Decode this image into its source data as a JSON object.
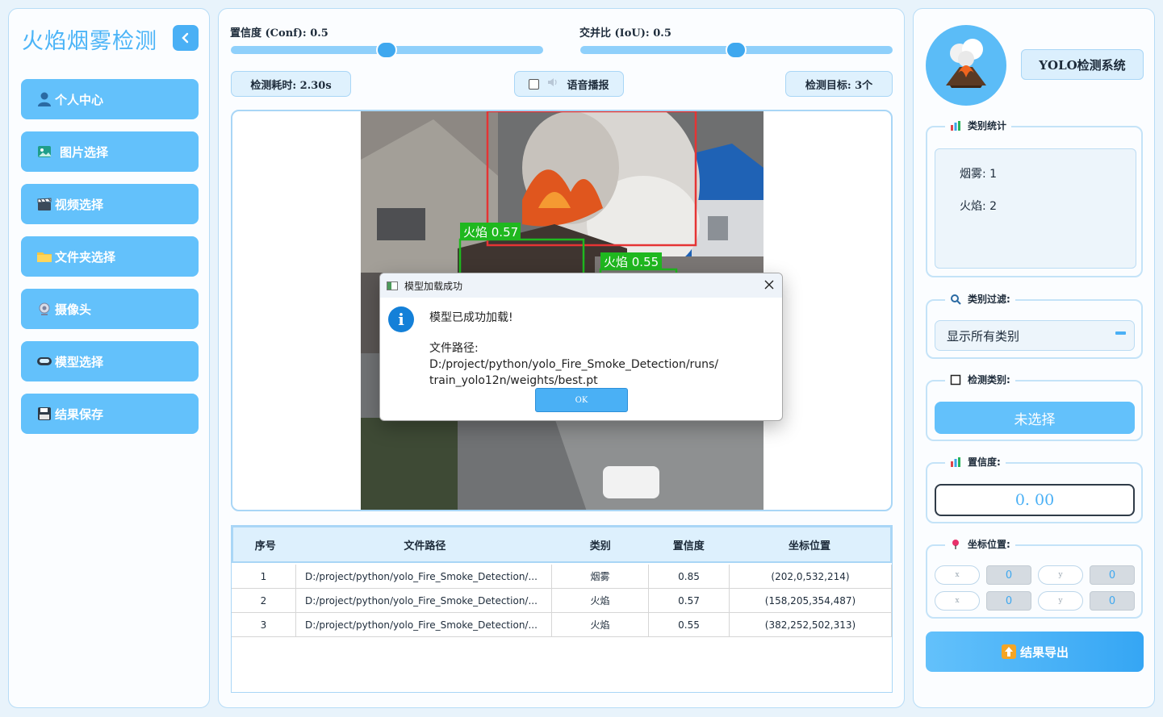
{
  "sidebar": {
    "title": "火焰烟雾检测",
    "items": [
      {
        "label": "个人中心",
        "icon": "user-icon"
      },
      {
        "label": "图片选择",
        "icon": "image-icon"
      },
      {
        "label": "视频选择",
        "icon": "clapper-icon"
      },
      {
        "label": "文件夹选择",
        "icon": "folder-icon"
      },
      {
        "label": "摄像头",
        "icon": "webcam-icon"
      },
      {
        "label": "模型选择",
        "icon": "model-icon"
      },
      {
        "label": "结果保存",
        "icon": "floppy-icon"
      }
    ]
  },
  "controls": {
    "conf_label": "置信度 (Conf): 0.5",
    "conf_value": 0.5,
    "iou_label": "交并比 (IoU): 0.5",
    "iou_value": 0.5,
    "time_label": "检测耗时: 2.30s",
    "voice_label": "语音播报",
    "target_label": "检测目标: 3个"
  },
  "detections_overlay": [
    {
      "label": "火焰 0.57",
      "color": "#1fb81f"
    },
    {
      "label": "火焰 0.55",
      "color": "#1fb81f"
    }
  ],
  "table": {
    "headers": [
      "序号",
      "文件路径",
      "类别",
      "置信度",
      "坐标位置"
    ],
    "rows": [
      {
        "idx": "1",
        "path": "D:/project/python/yolo_Fire_Smoke_Detection/...",
        "cls": "烟雾",
        "conf": "0.85",
        "box": "(202,0,532,214)"
      },
      {
        "idx": "2",
        "path": "D:/project/python/yolo_Fire_Smoke_Detection/...",
        "cls": "火焰",
        "conf": "0.57",
        "box": "(158,205,354,487)"
      },
      {
        "idx": "3",
        "path": "D:/project/python/yolo_Fire_Smoke_Detection/...",
        "cls": "火焰",
        "conf": "0.55",
        "box": "(382,252,502,313)"
      }
    ]
  },
  "right": {
    "system_title": "YOLO检测系统",
    "stats_label": "类别统计",
    "stats": [
      "烟雾: 1",
      "火焰: 2"
    ],
    "filter_label": "类别过滤:",
    "filter_value": "显示所有类别",
    "class_label": "检测类别:",
    "class_value": "未选择",
    "conf_label": "置信度:",
    "conf_value": "0. 00",
    "coord_label": "坐标位置:",
    "coords": [
      {
        "axis": "x",
        "value": "0"
      },
      {
        "axis": "y",
        "value": "0"
      },
      {
        "axis": "x",
        "value": "0"
      },
      {
        "axis": "y",
        "value": "0"
      }
    ],
    "export_label": "结果导出"
  },
  "dialog": {
    "title": "模型加载成功",
    "message": "模型已成功加载!",
    "path_line1": "文件路径: D:/project/python/yolo_Fire_Smoke_Detection/runs/",
    "path_line2": "train_yolo12n/weights/best.pt",
    "ok_label": "OK"
  },
  "colors": {
    "accent": "#4ab0f5",
    "button": "#63c1fb",
    "panel_border": "#b7dcf6"
  }
}
